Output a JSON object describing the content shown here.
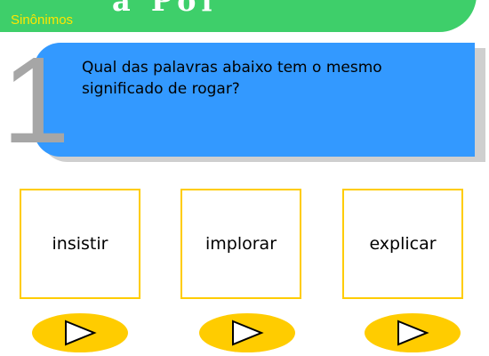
{
  "header": {
    "title_fragment": "a Pol",
    "subtitle": "Sinônimos",
    "color": "#3ecf6a",
    "subtitle_color": "#ffe600"
  },
  "question": {
    "number": "1",
    "text": "Qual das palavras abaixo tem o mesmo significado de rogar?",
    "card_color": "#3399ff"
  },
  "options": [
    {
      "label": "insistir",
      "button_icon": "play-icon"
    },
    {
      "label": "implorar",
      "button_icon": "play-icon"
    },
    {
      "label": "explicar",
      "button_icon": "play-icon"
    }
  ],
  "accent_color": "#ffcc00"
}
